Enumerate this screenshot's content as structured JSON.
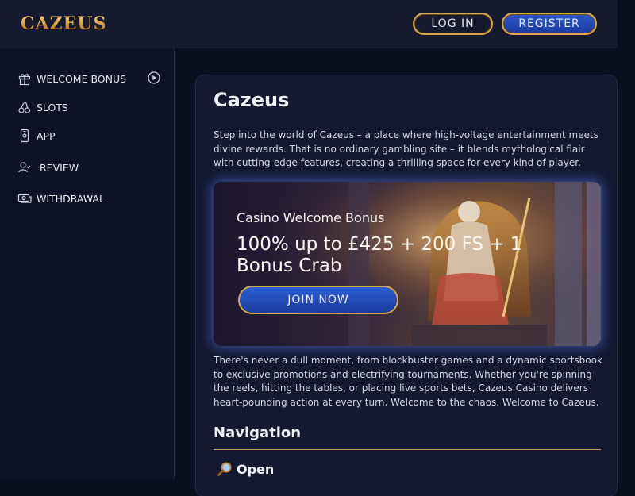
{
  "header": {
    "logo": "CAZEUS",
    "login_label": "LOG IN",
    "register_label": "REGISTER"
  },
  "sidebar": {
    "items": [
      {
        "label": "WELCOME BONUS",
        "icon": "gift-icon"
      },
      {
        "label": "SLOTS",
        "icon": "cherries-icon"
      },
      {
        "label": "APP",
        "icon": "phone-icon"
      },
      {
        "label": "REVIEW",
        "icon": "user-check-icon"
      },
      {
        "label": "WITHDRAWAL",
        "icon": "cash-icon"
      }
    ]
  },
  "main": {
    "title": "Cazeus",
    "intro": "Step into the world of Cazeus – a place where high-voltage entertainment meets divine rewards. That is no ordinary gambling site – it blends mythological flair with cutting-edge features, creating a thrilling space for every kind of player.",
    "banner": {
      "subtitle": "Casino Welcome Bonus",
      "headline": "100% up to £425 + 200 FS + 1 Bonus Crab",
      "cta": "JOIN NOW"
    },
    "body": "There's never a dull moment, from blockbuster games and a dynamic sportsbook to exclusive promotions and electrifying tournaments. Whether you're spinning the reels, hitting the tables, or placing live sports bets, Cazeus Casino delivers heart-pounding action at every turn. Welcome to the chaos. Welcome to Cazeus.",
    "nav_heading": "Navigation",
    "open_label": "Open"
  },
  "colors": {
    "background": "#0b0f22",
    "gold": "#d9a64a",
    "blue": "#2a59c9"
  }
}
